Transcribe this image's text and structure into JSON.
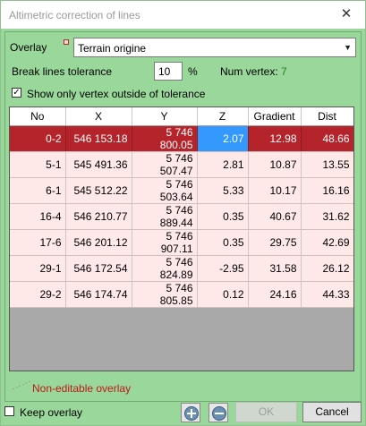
{
  "window": {
    "title": "Altimetric correction of lines",
    "close_glyph": "✕"
  },
  "overlay": {
    "label": "Overlay",
    "selected": "Terrain origine",
    "arrow": "▼"
  },
  "tolerance": {
    "label": "Break lines tolerance",
    "value": "10",
    "unit": "%",
    "vertex_label": "Num vertex:",
    "vertex_count": "7"
  },
  "show_outside": {
    "label": "Show only vertex outside of tolerance",
    "checked": true,
    "check_glyph": "✓"
  },
  "table": {
    "columns": [
      "No",
      "X",
      "Y",
      "Z",
      "Gradient",
      "Dist"
    ],
    "rows": [
      [
        "0-2",
        "546 153.18",
        "5 746 800.05",
        "2.07",
        "12.98",
        "48.66"
      ],
      [
        "5-1",
        "545 491.36",
        "5 746 507.47",
        "2.81",
        "10.87",
        "13.55"
      ],
      [
        "6-1",
        "545 512.22",
        "5 746 503.64",
        "5.33",
        "10.17",
        "16.16"
      ],
      [
        "16-4",
        "546 210.77",
        "5 746 889.44",
        "0.35",
        "40.67",
        "31.62"
      ],
      [
        "17-6",
        "546 201.12",
        "5 746 907.11",
        "0.35",
        "29.75",
        "42.69"
      ],
      [
        "29-1",
        "546 172.54",
        "5 746 824.89",
        "-2.95",
        "31.58",
        "26.12"
      ],
      [
        "29-2",
        "546 174.74",
        "5 746 805.85",
        "0.12",
        "24.16",
        "44.33"
      ]
    ]
  },
  "legend": {
    "label": "Non-editable overlay"
  },
  "footer": {
    "keep_label": "Keep overlay",
    "ok_label": "OK",
    "cancel_label": "Cancel"
  },
  "colors": {
    "background": "#99d89a",
    "selected_row": "#b5242a",
    "row": "#ffe8e8",
    "current_cell": "#3399ff",
    "legend_text": "#c01818"
  },
  "icons": {
    "add": "plus-globe-icon",
    "remove": "minus-globe-icon"
  }
}
